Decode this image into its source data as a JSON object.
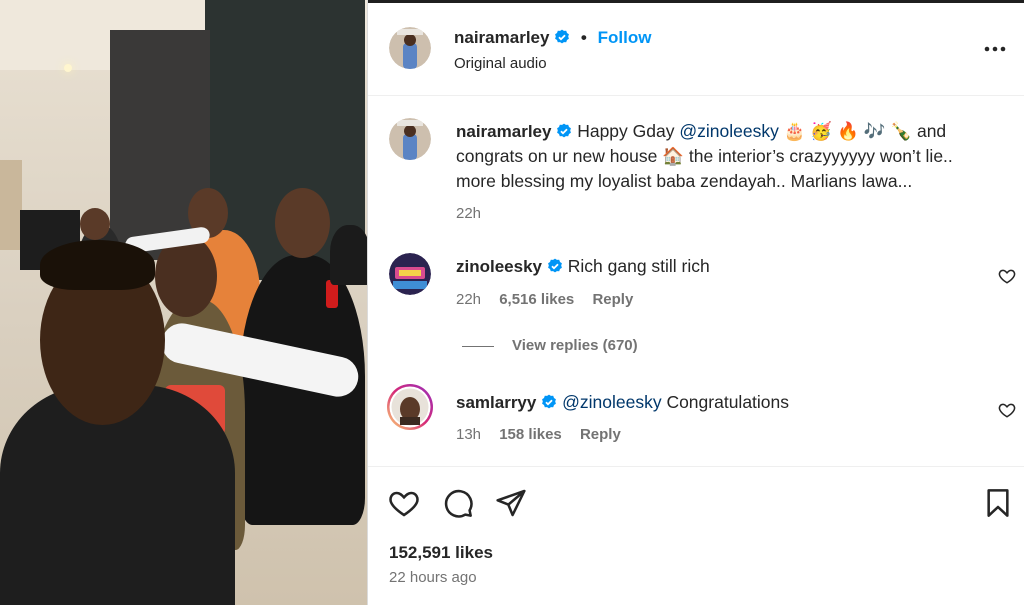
{
  "post": {
    "author": "nairamarley",
    "follow_label": "Follow",
    "dot": "•",
    "audio": "Original audio",
    "more_icon": "more-horizontal-icon"
  },
  "caption": {
    "username": "nairamarley",
    "text_before": "Happy Gday ",
    "mention": "@zinoleesky",
    "emojis": "🎂 🥳 🔥 🎶 🍾",
    "text_after": " and congrats on ur new house 🏠 the interior’s crazyyyyyy won’t lie.. more blessing my loyalist baba zendayah.. Marlians lawa...",
    "time": "22h"
  },
  "comments": [
    {
      "username": "zinoleesky",
      "text": "Rich gang still rich",
      "time": "22h",
      "likes": "6,516 likes",
      "reply_label": "Reply",
      "view_replies": "View replies (670)"
    },
    {
      "username": "samlarryy",
      "mention": "@zinoleesky",
      "text": " Congratulations",
      "time": "13h",
      "likes": "158 likes",
      "reply_label": "Reply"
    }
  ],
  "stats": {
    "likes": "152,591 likes",
    "time_ago": "22 hours ago"
  },
  "colors": {
    "accent": "#0095f6",
    "verified": "#0095f6",
    "muted": "#737373",
    "mention": "#00376b"
  },
  "icons": [
    "heart-icon",
    "comment-icon",
    "share-icon",
    "bookmark-icon",
    "verified-icon"
  ]
}
